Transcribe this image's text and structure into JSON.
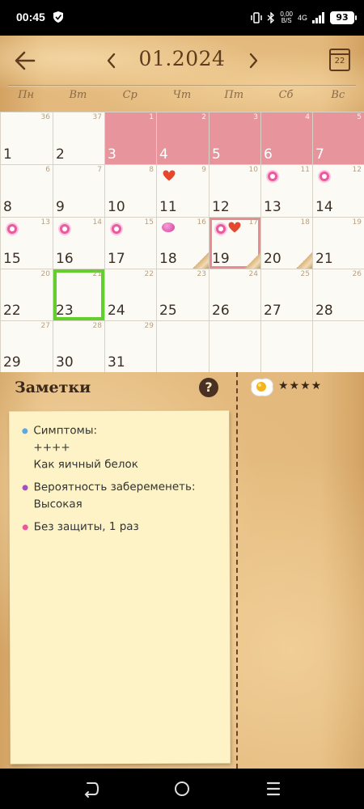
{
  "status_bar": {
    "time": "00:45",
    "speed_value": "0,00",
    "speed_unit": "B/S",
    "network": "4G",
    "battery": "93"
  },
  "header": {
    "title": "01.2024",
    "today_icon_day": "22",
    "weekdays": [
      "Пн",
      "Вт",
      "Ср",
      "Чт",
      "Пт",
      "Сб",
      "Вс"
    ]
  },
  "calendar": {
    "weeks": [
      {
        "week_numbers": [
          "36",
          "37",
          "1",
          "2",
          "3",
          "4",
          "5"
        ],
        "days": [
          "1",
          "2",
          "3",
          "4",
          "5",
          "6",
          "7"
        ]
      },
      {
        "week_numbers": [
          "6",
          "7",
          "8",
          "9",
          "10",
          "11",
          "12"
        ],
        "days": [
          "8",
          "9",
          "10",
          "11",
          "12",
          "13",
          "14"
        ]
      },
      {
        "week_numbers": [
          "13",
          "14",
          "15",
          "16",
          "17",
          "18",
          "19"
        ],
        "days": [
          "15",
          "16",
          "17",
          "18",
          "19",
          "20",
          "21"
        ]
      },
      {
        "week_numbers": [
          "20",
          "21",
          "22",
          "23",
          "24",
          "25",
          "26"
        ],
        "days": [
          "22",
          "23",
          "24",
          "25",
          "26",
          "27",
          "28"
        ]
      },
      {
        "week_numbers": [
          "27",
          "28",
          "29",
          "",
          "",
          "",
          ""
        ],
        "days": [
          "29",
          "30",
          "31",
          "",
          "",
          "",
          ""
        ]
      }
    ],
    "period_color": "#e8949c",
    "selected_color": "#ea8a94",
    "current_color": "#63cf2c"
  },
  "notes": {
    "title": "Заметки",
    "help": "?",
    "items": [
      {
        "color": "#5aa9e6",
        "lines": [
          "Симптомы:",
          "++++",
          "Как яичный белок"
        ]
      },
      {
        "color": "#a34fc2",
        "lines": [
          "Вероятность забеременеть:",
          "Высокая"
        ]
      },
      {
        "color": "#e8589b",
        "lines": [
          "Без защиты, 1 раз"
        ]
      }
    ],
    "rating": "★★★★",
    "rating_icon": "fried-egg-icon"
  },
  "nav": {
    "icons": [
      "back-icon",
      "home-icon",
      "recents-icon"
    ]
  }
}
